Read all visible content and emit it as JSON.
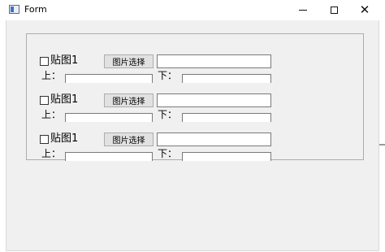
{
  "window": {
    "title": "Form",
    "controls": {
      "minimize": "—",
      "maximize": "☐",
      "close": "✕"
    }
  },
  "rows": [
    {
      "checkbox_label": "贴图1",
      "button_label": "图片选择",
      "path_value": "",
      "up_label": "上：",
      "up_value": "",
      "down_label": "下：",
      "down_value": ""
    },
    {
      "checkbox_label": "贴图1",
      "button_label": "图片选择",
      "path_value": "",
      "up_label": "上：",
      "up_value": "",
      "down_label": "下：",
      "down_value": ""
    },
    {
      "checkbox_label": "贴图1",
      "button_label": "图片选择",
      "path_value": "",
      "up_label": "上：",
      "up_value": "",
      "down_label": "下：",
      "down_value": ""
    }
  ]
}
